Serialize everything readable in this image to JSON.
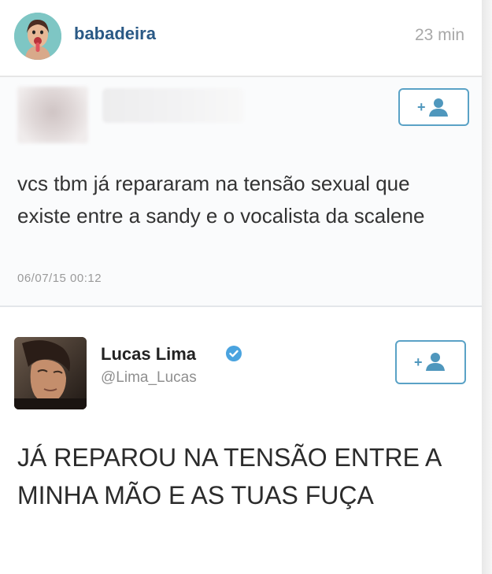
{
  "post": {
    "username": "babadeira",
    "time": "23 min"
  },
  "tweet1": {
    "text": "vcs tbm já repararam na tensão sexual que existe entre a sandy e o vocalista da scalene",
    "date": "06/07/15 00:12"
  },
  "tweet2": {
    "display_name": "Lucas Lima",
    "handle": "@Lima_Lucas",
    "text": "JÁ REPAROU NA TENSÃO ENTRE A MINHA MÃO E AS TUAS FUÇA"
  },
  "icons": {
    "follow": "add-user-icon",
    "verified": "verified-badge-icon"
  },
  "colors": {
    "username": "#2a5985",
    "follow_border": "#5aa2c6",
    "verified": "#4aa3df"
  }
}
